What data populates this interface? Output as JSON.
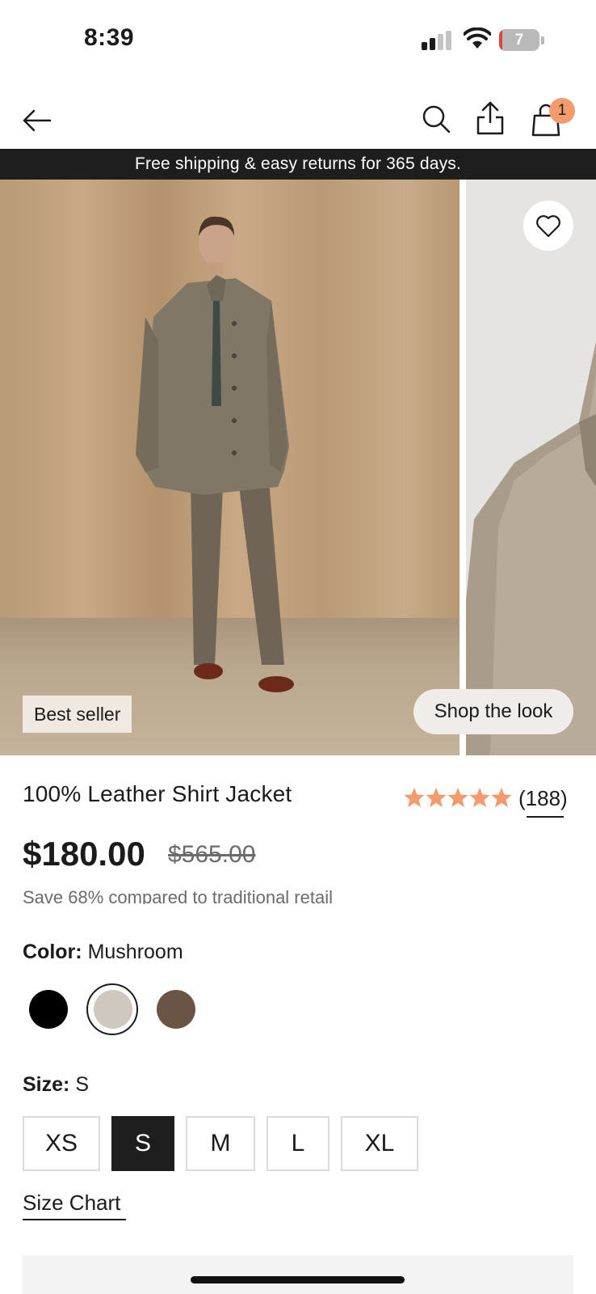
{
  "status_bar": {
    "time": "8:39",
    "battery": "7",
    "battery_level": 0.07
  },
  "nav": {
    "cart_count": "1"
  },
  "promo_banner": "Free shipping & easy returns for 365 days.",
  "gallery": {
    "badge": "Best seller",
    "shop_the_look": "Shop the look"
  },
  "product": {
    "title": "100% Leather Shirt Jacket",
    "rating": 5,
    "review_count": "(188)",
    "price": "$180.00",
    "original_price": "$565.00",
    "savings": "Save 68% compared to traditional retail"
  },
  "color": {
    "label": "Color:",
    "selected": "Mushroom",
    "swatches": [
      {
        "name": "black",
        "hex": "#000000"
      },
      {
        "name": "mushroom",
        "hex": "#cfc8bf"
      },
      {
        "name": "brown",
        "hex": "#6a5446"
      }
    ]
  },
  "size": {
    "label": "Size:",
    "selected": "S",
    "options": [
      "XS",
      "S",
      "M",
      "L",
      "XL"
    ]
  },
  "size_chart": "Size Chart",
  "colors": {
    "accent": "#f39b6d",
    "banner": "#1e1e1e"
  }
}
